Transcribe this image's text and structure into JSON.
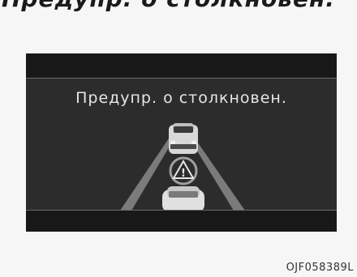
{
  "page": {
    "top_fragment": "Предупр. о столкновен.",
    "image_code": "OJF058389L"
  },
  "display": {
    "warning_message": "Предупр. о столкновен.",
    "warning_symbol": "!"
  },
  "colors": {
    "background": "#f6f6f6",
    "panel": "#2c2c2c",
    "panel_band": "#181818",
    "text": "#e6e6e6",
    "lane": "#8a8a8a",
    "car": "#d8d8d8"
  }
}
